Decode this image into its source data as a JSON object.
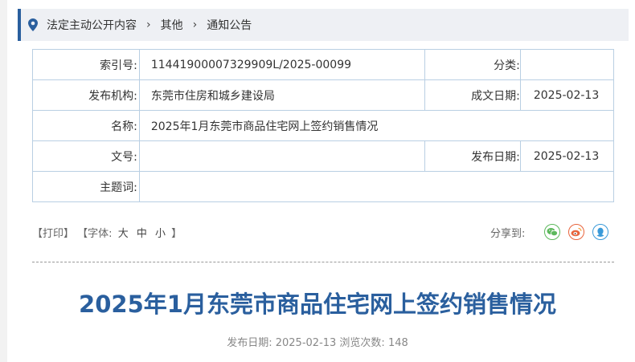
{
  "breadcrumb": {
    "items": [
      "法定主动公开内容",
      "其他",
      "通知公告"
    ],
    "separator": "›"
  },
  "meta": {
    "index_label": "索引号:",
    "index_value": "11441900007329909L/2025-00099",
    "category_label": "分类:",
    "category_value": "",
    "publisher_label": "发布机构:",
    "publisher_value": "东莞市住房和城乡建设局",
    "written_date_label": "成文日期:",
    "written_date_value": "2025-02-13",
    "name_label": "名称:",
    "name_value": "2025年1月东莞市商品住宅网上签约销售情况",
    "doc_no_label": "文号:",
    "doc_no_value": "",
    "publish_date_label": "发布日期:",
    "publish_date_value": "2025-02-13",
    "subject_label": "主题词:",
    "subject_value": ""
  },
  "tools": {
    "print": "【打印】",
    "font_prefix": "【字体:",
    "font_large": "大",
    "font_medium": "中",
    "font_small": "小",
    "font_suffix": "】",
    "share_label": "分享到:"
  },
  "article": {
    "title": "2025年1月东莞市商品住宅网上签约销售情况",
    "publish_info": "发布日期: 2025-02-13  浏览次数: 148"
  },
  "colors": {
    "accent": "#2a5f9e",
    "border": "#b9cfe3",
    "wechat": "#5cb85c",
    "weibo": "#e8643c",
    "qq": "#3a9ad9"
  },
  "icons": [
    "location-pin-icon",
    "wechat-icon",
    "weibo-icon",
    "qq-icon"
  ]
}
